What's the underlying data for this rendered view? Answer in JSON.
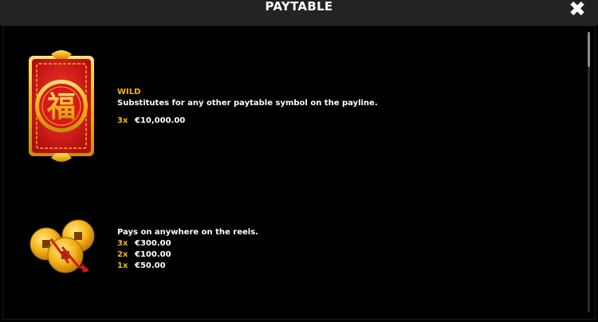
{
  "header": {
    "title": "PAYTABLE",
    "close_icon": "close-icon"
  },
  "symbols": [
    {
      "icon": "wild-fu-symbol-icon",
      "name": "WILD",
      "description": "Substitutes for any other paytable symbol on the payline.",
      "payouts": [
        {
          "mult": "3x",
          "amount": "€10,000.00"
        }
      ]
    },
    {
      "icon": "gold-coins-scatter-icon",
      "name": "",
      "description": "Pays on anywhere on the reels.",
      "payouts": [
        {
          "mult": "3x",
          "amount": "€300.00"
        },
        {
          "mult": "2x",
          "amount": "€100.00"
        },
        {
          "mult": "1x",
          "amount": "€50.00"
        }
      ]
    }
  ],
  "colors": {
    "accent": "#f5b318",
    "header_bg": "#232323",
    "background": "#000000",
    "symbol_red": "#d7191c",
    "symbol_gold": "#f2b31a"
  }
}
